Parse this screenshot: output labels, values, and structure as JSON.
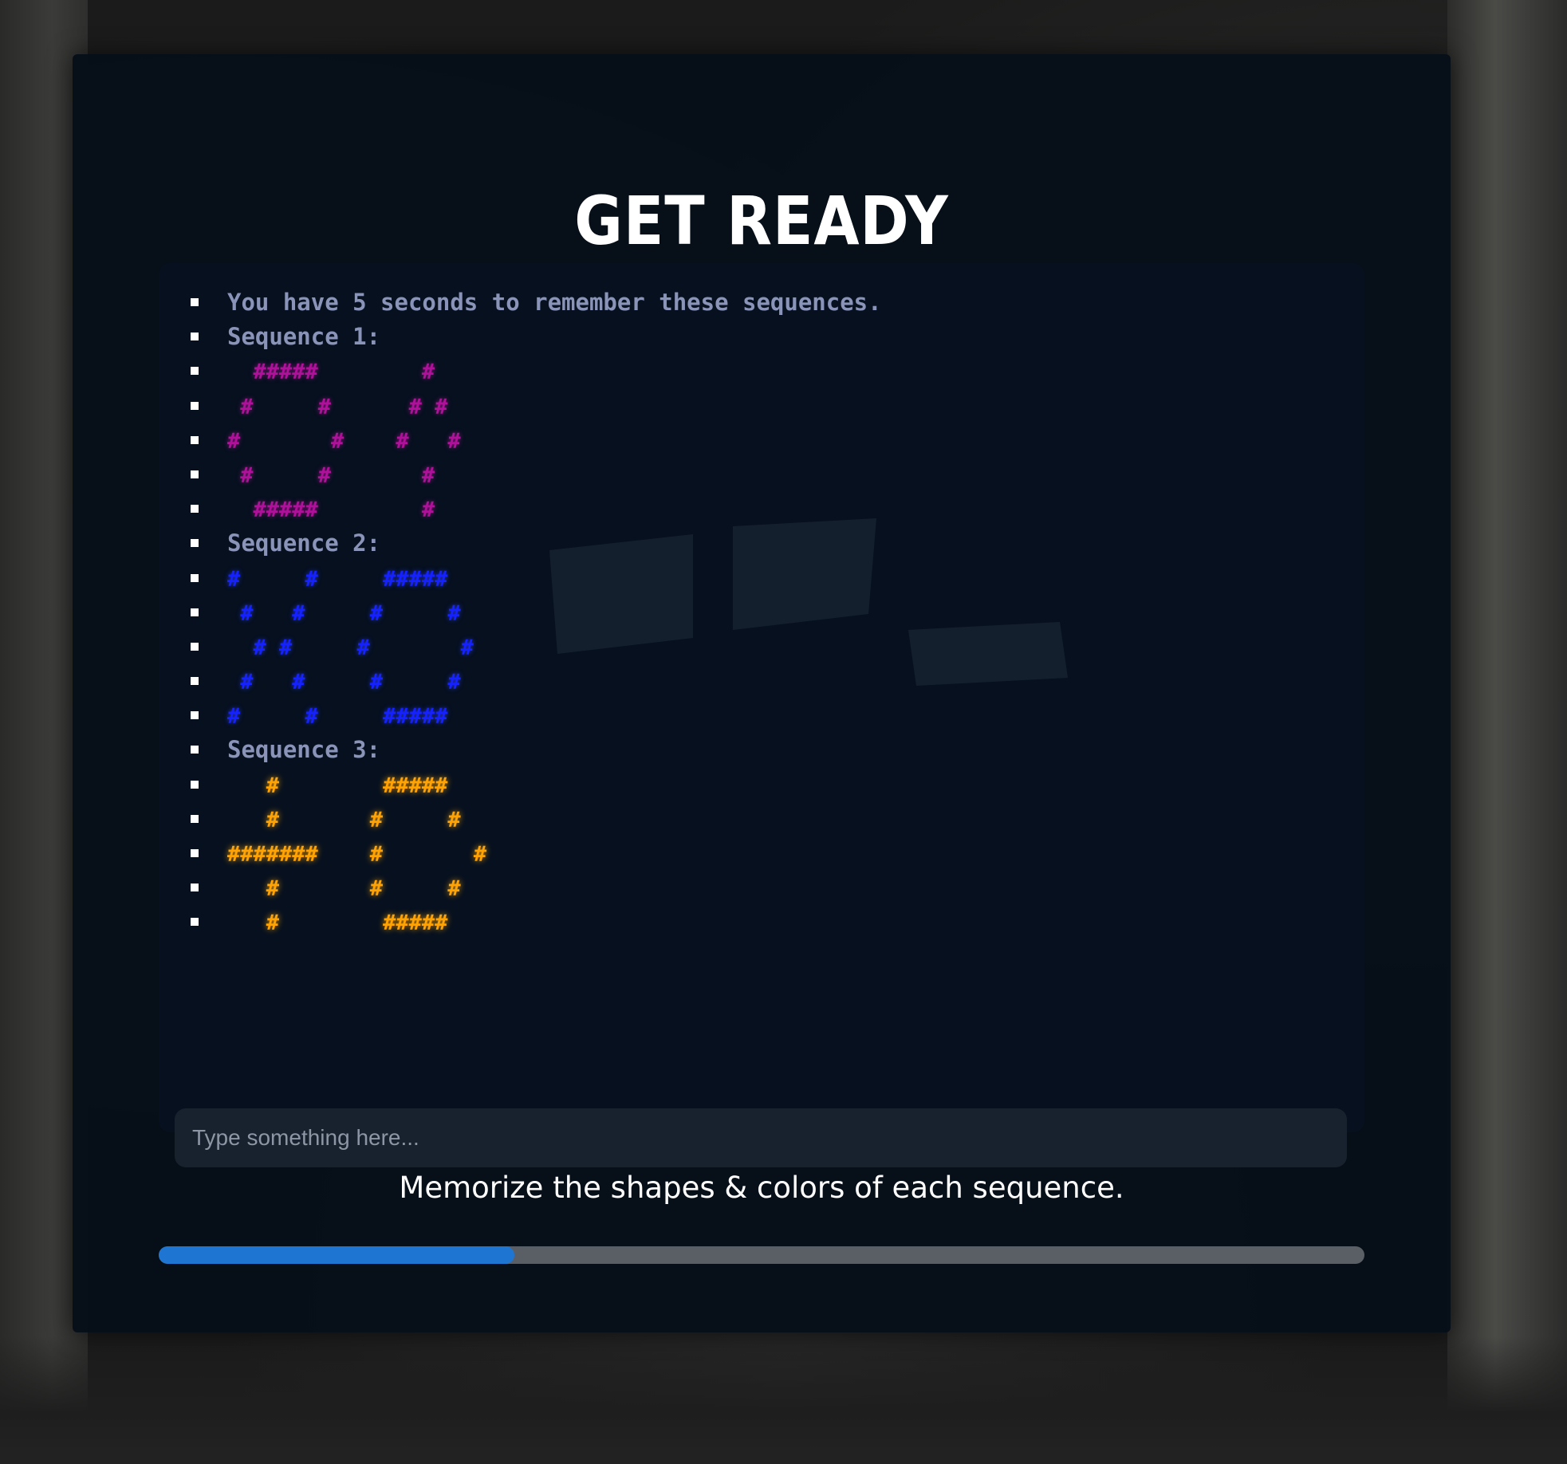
{
  "title": "GET READY",
  "terminal": {
    "lines": [
      {
        "text": "You have 5 seconds to remember these sequences.",
        "style": "info"
      },
      {
        "text": "Sequence 1:",
        "style": "info"
      },
      {
        "text": "  #####        #",
        "style": "magenta"
      },
      {
        "text": " #     #      # #",
        "style": "magenta"
      },
      {
        "text": "#       #    #   #",
        "style": "magenta"
      },
      {
        "text": " #     #       #",
        "style": "magenta"
      },
      {
        "text": "  #####        #",
        "style": "magenta"
      },
      {
        "text": "Sequence 2:",
        "style": "info"
      },
      {
        "text": "#     #     #####",
        "style": "blue"
      },
      {
        "text": " #   #     #     #",
        "style": "blue"
      },
      {
        "text": "  # #     #       #",
        "style": "blue"
      },
      {
        "text": " #   #     #     #",
        "style": "blue"
      },
      {
        "text": "#     #     #####",
        "style": "blue"
      },
      {
        "text": "Sequence 3:",
        "style": "info"
      },
      {
        "text": "   #        #####",
        "style": "orange"
      },
      {
        "text": "   #       #     #",
        "style": "orange"
      },
      {
        "text": "#######    #       #",
        "style": "orange"
      },
      {
        "text": "   #       #     #",
        "style": "orange"
      },
      {
        "text": "   #        #####",
        "style": "orange"
      }
    ],
    "input_placeholder": "Type something here...",
    "input_value": ""
  },
  "hint": "Memorize the shapes & colors of each sequence.",
  "progress": {
    "fraction": 0.295
  },
  "colors": {
    "magenta": "#b0119a",
    "blue": "#1522ff",
    "orange": "#ffa305",
    "info_text": "#8a93b8",
    "progress_fill": "#1f76d2",
    "progress_track": "#5a5f66"
  }
}
